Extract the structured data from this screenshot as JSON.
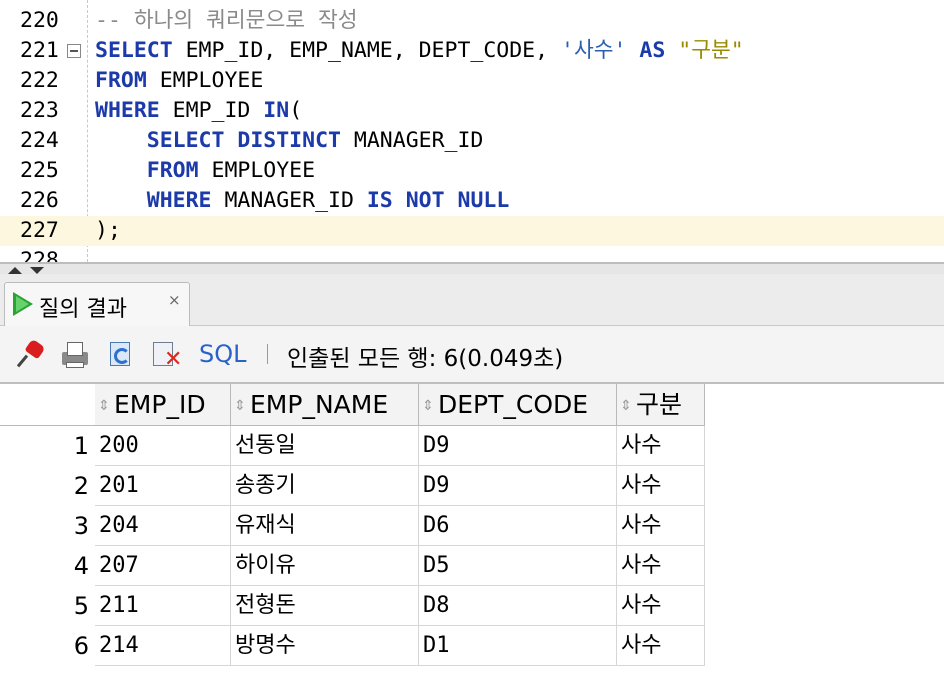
{
  "editor": {
    "lines": [
      {
        "no": "220",
        "tokens": [
          {
            "t": "-- 하나의 쿼리문으로 작성",
            "c": "cmt"
          }
        ]
      },
      {
        "no": "221",
        "fold": true,
        "tokens": [
          {
            "t": "SELECT",
            "c": "kw"
          },
          {
            "t": " EMP_ID, EMP_NAME, DEPT_CODE, ",
            "c": ""
          },
          {
            "t": "'사수'",
            "c": "str1"
          },
          {
            "t": " ",
            "c": ""
          },
          {
            "t": "AS",
            "c": "kw"
          },
          {
            "t": " ",
            "c": ""
          },
          {
            "t": "\"구분\"",
            "c": "str2"
          }
        ]
      },
      {
        "no": "222",
        "tokens": [
          {
            "t": "FROM",
            "c": "kw"
          },
          {
            "t": " EMPLOYEE",
            "c": ""
          }
        ]
      },
      {
        "no": "223",
        "tokens": [
          {
            "t": "WHERE",
            "c": "kw"
          },
          {
            "t": " EMP_ID ",
            "c": ""
          },
          {
            "t": "IN",
            "c": "kw"
          },
          {
            "t": "(",
            "c": ""
          }
        ]
      },
      {
        "no": "224",
        "tokens": [
          {
            "t": "    ",
            "c": ""
          },
          {
            "t": "SELECT",
            "c": "kw"
          },
          {
            "t": " ",
            "c": ""
          },
          {
            "t": "DISTINCT",
            "c": "kw"
          },
          {
            "t": " MANAGER_ID",
            "c": ""
          }
        ]
      },
      {
        "no": "225",
        "tokens": [
          {
            "t": "    ",
            "c": ""
          },
          {
            "t": "FROM",
            "c": "kw"
          },
          {
            "t": " EMPLOYEE",
            "c": ""
          }
        ]
      },
      {
        "no": "226",
        "tokens": [
          {
            "t": "    ",
            "c": ""
          },
          {
            "t": "WHERE",
            "c": "kw"
          },
          {
            "t": " MANAGER_ID ",
            "c": ""
          },
          {
            "t": "IS",
            "c": "kw"
          },
          {
            "t": " ",
            "c": ""
          },
          {
            "t": "NOT",
            "c": "kw"
          },
          {
            "t": " ",
            "c": ""
          },
          {
            "t": "NULL",
            "c": "kw"
          }
        ]
      },
      {
        "no": "227",
        "current": true,
        "tokens": [
          {
            "t": ");",
            "c": ""
          }
        ]
      },
      {
        "no": "228",
        "tokens": []
      }
    ]
  },
  "result_tab": {
    "label": "질의 결과",
    "close": "×",
    "icon": "play-icon"
  },
  "toolbar": {
    "icons": [
      "pin-icon",
      "print-icon",
      "refresh-icon",
      "clear-icon"
    ],
    "sql_label": "SQL",
    "status": "인출된 모든 행: 6(0.049초)"
  },
  "grid": {
    "columns": [
      "EMP_ID",
      "EMP_NAME",
      "DEPT_CODE",
      "구분"
    ],
    "rows": [
      {
        "num": "1",
        "cells": [
          "200",
          "선동일",
          "D9",
          "사수"
        ]
      },
      {
        "num": "2",
        "cells": [
          "201",
          "송종기",
          "D9",
          "사수"
        ]
      },
      {
        "num": "3",
        "cells": [
          "204",
          "유재식",
          "D6",
          "사수"
        ]
      },
      {
        "num": "4",
        "cells": [
          "207",
          "하이유",
          "D5",
          "사수"
        ]
      },
      {
        "num": "5",
        "cells": [
          "211",
          "전형돈",
          "D8",
          "사수"
        ]
      },
      {
        "num": "6",
        "cells": [
          "214",
          "방명수",
          "D1",
          "사수"
        ]
      }
    ]
  },
  "colors": {
    "keyword": "#1c3aa9",
    "string_single": "#2a5fb0",
    "string_double": "#9a8a00",
    "comment": "#8a8a8a",
    "current_line": "#fdf7df",
    "sql_link": "#2b62c9"
  }
}
